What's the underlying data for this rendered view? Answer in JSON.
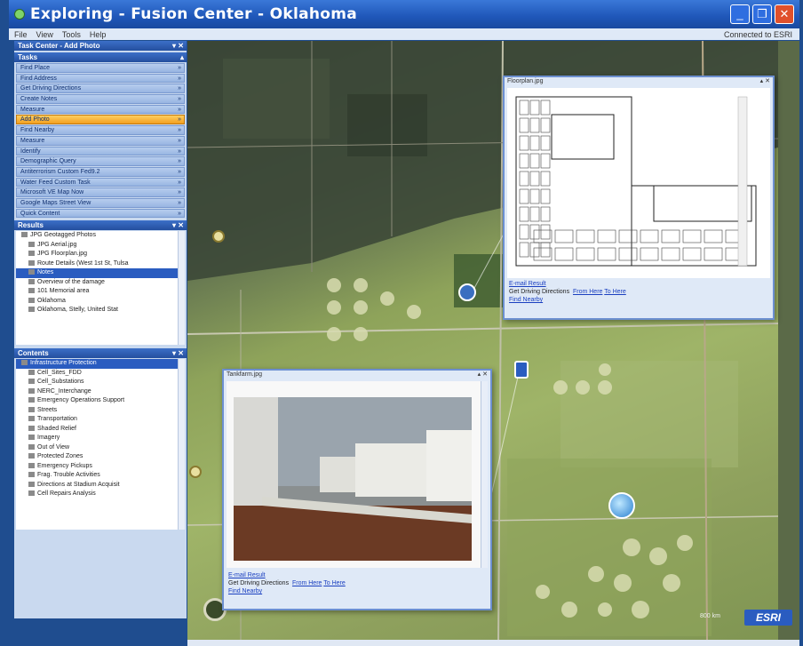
{
  "window": {
    "title": "Exploring - Fusion Center - Oklahoma",
    "minimize": "_",
    "restore": "❐",
    "close": "✕"
  },
  "menu": {
    "items": [
      "File",
      "View",
      "Tools",
      "Help"
    ],
    "status": "Connected to ESRI"
  },
  "task_center": {
    "header": "Task Center - Add Photo",
    "tasks_header": "Tasks",
    "tasks": [
      {
        "label": "Find Place",
        "active": false
      },
      {
        "label": "Find Address",
        "active": false
      },
      {
        "label": "Get Driving Directions",
        "active": false
      },
      {
        "label": "Create Notes",
        "active": false
      },
      {
        "label": "Measure",
        "active": false
      },
      {
        "label": "Add Photo",
        "active": true
      },
      {
        "label": "Find Nearby",
        "active": false
      },
      {
        "label": "Measure",
        "active": false
      },
      {
        "label": "Identify",
        "active": false
      },
      {
        "label": "Demographic Query",
        "active": false
      },
      {
        "label": "Antiterrorism Custom Fed9.2",
        "active": false
      },
      {
        "label": "Water Feed Custom Task",
        "active": false
      },
      {
        "label": "Microsoft VE Map Now",
        "active": false
      },
      {
        "label": "Google Maps Street View",
        "active": false
      },
      {
        "label": "Quick Content",
        "active": false
      }
    ]
  },
  "results": {
    "header": "Results",
    "items": [
      {
        "label": "JPG Geotagged Photos",
        "selected": false
      },
      {
        "label": "JPG Aerial.jpg",
        "selected": false
      },
      {
        "label": "JPG Floorplan.jpg",
        "selected": false
      },
      {
        "label": "Route Details (West 1st St, Tulsa",
        "selected": false
      },
      {
        "label": "Notes",
        "selected": true
      },
      {
        "label": "Overview of the damage",
        "selected": false
      },
      {
        "label": "101 Memorial area",
        "selected": false
      },
      {
        "label": "Oklahoma",
        "selected": false
      },
      {
        "label": "Oklahoma, Stelly, United Stat",
        "selected": false
      }
    ]
  },
  "contents": {
    "header": "Contents",
    "items": [
      {
        "label": "Infrastructure Protection",
        "selected": true
      },
      {
        "label": "Cell_Sites_FDD",
        "selected": false
      },
      {
        "label": "Cell_Substations",
        "selected": false
      },
      {
        "label": "NERC_Interchange",
        "selected": false
      },
      {
        "label": "Emergency Operations Support",
        "selected": false
      },
      {
        "label": "Streets",
        "selected": false
      },
      {
        "label": "Transportation",
        "selected": false
      },
      {
        "label": "Shaded Relief",
        "selected": false
      },
      {
        "label": "Imagery",
        "selected": false
      },
      {
        "label": "Out of View",
        "selected": false
      },
      {
        "label": "Protected Zones",
        "selected": false
      },
      {
        "label": "Emergency Pickups",
        "selected": false
      },
      {
        "label": "Frag. Trouble Activities",
        "selected": false
      },
      {
        "label": "Directions at Stadium Acquisit",
        "selected": false
      },
      {
        "label": "Cell Repairs Analysis",
        "selected": false
      }
    ]
  },
  "popup_floorplan": {
    "title": "Floorplan.jpg",
    "link1": "E-mail Result",
    "driving_label": "Get Driving Directions",
    "from_here": "From Here",
    "to_here": "To Here",
    "find_nearby": "Find Nearby"
  },
  "popup_tank": {
    "title": "Tankfarm.jpg",
    "link1": "E-mail Result",
    "driving_label": "Get Driving Directions",
    "from_here": "From Here",
    "to_here": "To Here",
    "find_nearby": "Find Nearby"
  },
  "map": {
    "scale_text": "800 km",
    "logo": "ESRI"
  },
  "colors": {
    "title_bar": "#1f56b8",
    "active_task": "#f2a020",
    "link": "#1a3fc0"
  }
}
